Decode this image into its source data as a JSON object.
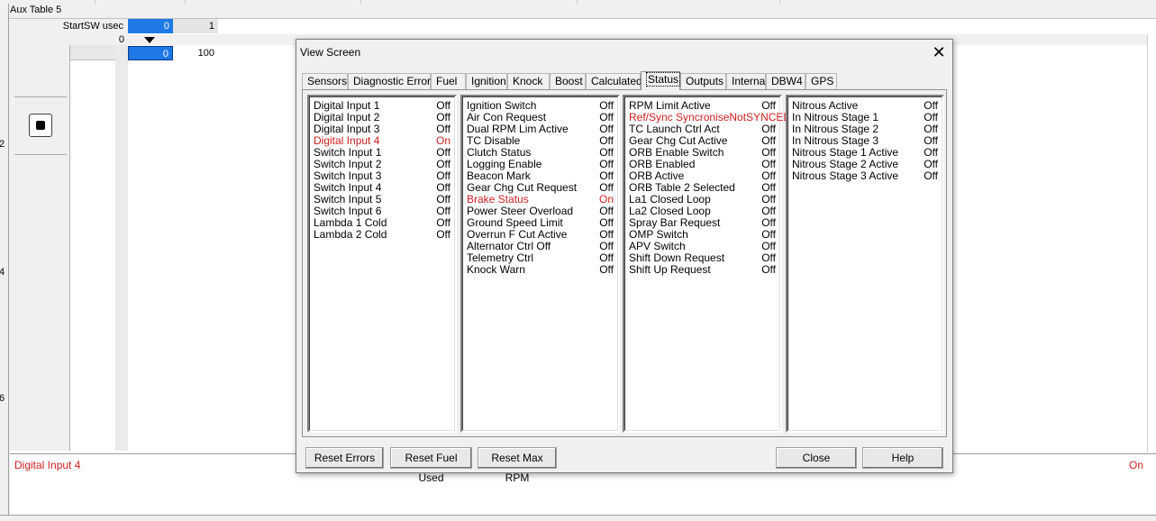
{
  "app": {
    "aux_title": "Aux Table 5",
    "left_edge_chars": [
      "2",
      "4",
      "6"
    ],
    "header_label": "StartSW usec",
    "header_cells": [
      "0",
      "1"
    ],
    "row_axis_label": "0",
    "row_cells": [
      "0",
      "100"
    ],
    "status_bar": {
      "label": "Digital Input 4",
      "value": "On"
    }
  },
  "dialog": {
    "title": "View Screen",
    "close_glyph": "✕",
    "tabs": [
      {
        "label": "Sensors"
      },
      {
        "label": "Diagnostic Errors"
      },
      {
        "label": "Fuel"
      },
      {
        "label": "Ignition"
      },
      {
        "label": "Knock"
      },
      {
        "label": "Boost"
      },
      {
        "label": "Calculated"
      },
      {
        "label": "Status",
        "active": true
      },
      {
        "label": "Outputs"
      },
      {
        "label": "Internal"
      },
      {
        "label": "DBW4"
      },
      {
        "label": "GPS"
      }
    ],
    "columns": [
      [
        {
          "name": "Digital Input 1",
          "value": "Off"
        },
        {
          "name": "Digital Input 2",
          "value": "Off"
        },
        {
          "name": "Digital Input 3",
          "value": "Off"
        },
        {
          "name": "Digital Input 4",
          "value": "On",
          "on": true
        },
        {
          "name": "Switch Input 1",
          "value": "Off"
        },
        {
          "name": "Switch Input 2",
          "value": "Off"
        },
        {
          "name": "Switch Input 3",
          "value": "Off"
        },
        {
          "name": "Switch Input 4",
          "value": "Off"
        },
        {
          "name": "Switch Input 5",
          "value": "Off"
        },
        {
          "name": "Switch Input 6",
          "value": "Off"
        },
        {
          "name": "Lambda 1 Cold",
          "value": "Off"
        },
        {
          "name": "Lambda 2 Cold",
          "value": "Off"
        }
      ],
      [
        {
          "name": "Ignition Switch",
          "value": "Off"
        },
        {
          "name": "Air Con Request",
          "value": "Off"
        },
        {
          "name": "Dual RPM Lim Active",
          "value": "Off"
        },
        {
          "name": "TC Disable",
          "value": "Off"
        },
        {
          "name": "Clutch Status",
          "value": "Off"
        },
        {
          "name": "Logging Enable",
          "value": "Off"
        },
        {
          "name": "Beacon Mark",
          "value": "Off"
        },
        {
          "name": "Gear Chg Cut Request",
          "value": "Off"
        },
        {
          "name": "Brake Status",
          "value": "On",
          "on": true
        },
        {
          "name": "Power Steer Overload",
          "value": "Off"
        },
        {
          "name": "Ground Speed Limit",
          "value": "Off"
        },
        {
          "name": "Overrun F Cut Active",
          "value": "Off"
        },
        {
          "name": "Alternator Ctrl Off",
          "value": "Off"
        },
        {
          "name": "Telemetry Ctrl",
          "value": "Off"
        },
        {
          "name": "Knock Warn",
          "value": "Off"
        }
      ],
      [
        {
          "name": "RPM Limit Active",
          "value": "Off"
        },
        {
          "name": "Ref/Sync SyncroniseNotSYNCED",
          "value": "",
          "on": true
        },
        {
          "name": "TC Launch Ctrl Act",
          "value": "Off"
        },
        {
          "name": "Gear Chg Cut Active",
          "value": "Off"
        },
        {
          "name": "ORB Enable Switch",
          "value": "Off"
        },
        {
          "name": "ORB Enabled",
          "value": "Off"
        },
        {
          "name": "ORB Active",
          "value": "Off"
        },
        {
          "name": "ORB Table 2 Selected",
          "value": "Off"
        },
        {
          "name": "La1 Closed Loop",
          "value": "Off"
        },
        {
          "name": "La2 Closed Loop",
          "value": "Off"
        },
        {
          "name": "Spray Bar Request",
          "value": "Off"
        },
        {
          "name": "OMP Switch",
          "value": "Off"
        },
        {
          "name": "APV Switch",
          "value": "Off"
        },
        {
          "name": "Shift Down Request",
          "value": "Off"
        },
        {
          "name": "Shift Up Request",
          "value": "Off"
        }
      ],
      [
        {
          "name": "Nitrous Active",
          "value": "Off"
        },
        {
          "name": "In Nitrous Stage 1",
          "value": "Off"
        },
        {
          "name": "In Nitrous Stage 2",
          "value": "Off"
        },
        {
          "name": "In Nitrous Stage 3",
          "value": "Off"
        },
        {
          "name": "Nitrous Stage 1 Active",
          "value": "Off"
        },
        {
          "name": "Nitrous Stage 2 Active",
          "value": "Off"
        },
        {
          "name": "Nitrous Stage 3 Active",
          "value": "Off"
        }
      ]
    ],
    "buttons": {
      "reset_errors": "Reset Errors",
      "reset_fuel_used": "Reset Fuel Used",
      "reset_max_rpm": "Reset Max RPM",
      "close": "Close",
      "help": "Help"
    },
    "colors": {
      "on_state": "#d21e1e",
      "selected_cell": "#1e78e6"
    }
  }
}
